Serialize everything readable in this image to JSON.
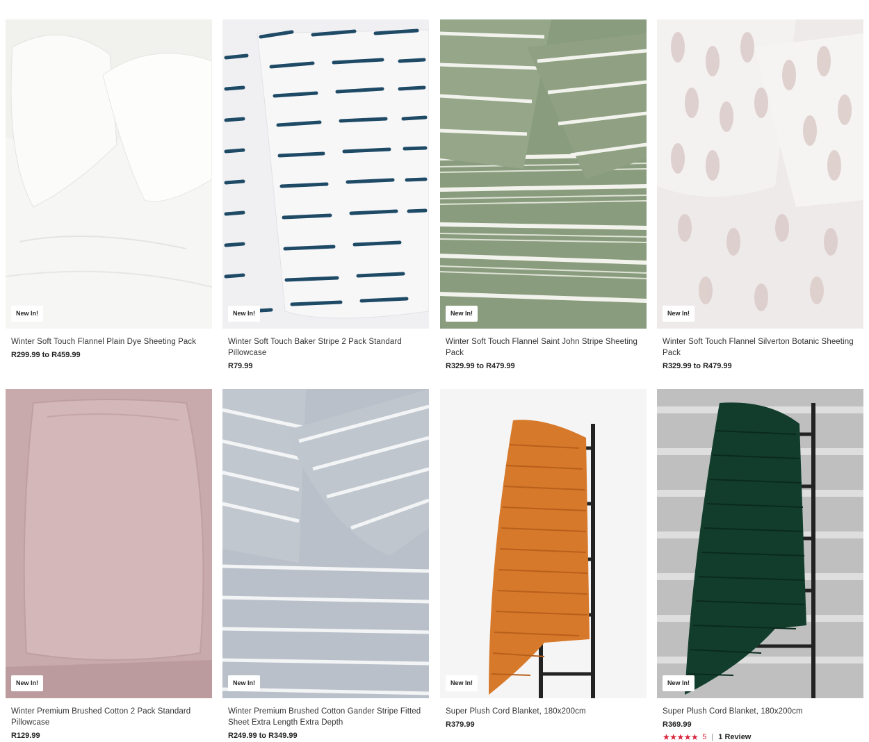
{
  "products": [
    {
      "badge": "New In!",
      "title": "Winter Soft Touch Flannel Plain Dye Sheeting Pack",
      "price": "R299.99 to R459.99"
    },
    {
      "badge": "New In!",
      "title": "Winter Soft Touch Baker Stripe 2 Pack Standard Pillowcase",
      "price": "R79.99"
    },
    {
      "badge": "New In!",
      "title": "Winter Soft Touch Flannel Saint John Stripe Sheeting Pack",
      "price": "R329.99 to R479.99"
    },
    {
      "badge": "New In!",
      "title": "Winter Soft Touch Flannel Silverton Botanic Sheeting Pack",
      "price": "R329.99 to R479.99"
    },
    {
      "badge": "New In!",
      "title": "Winter Premium Brushed Cotton 2 Pack Standard Pillowcase",
      "price": "R129.99"
    },
    {
      "badge": "New In!",
      "title": "Winter Premium Brushed Cotton Gander Stripe Fitted Sheet Extra Length Extra Depth",
      "price": "R249.99 to R349.99"
    },
    {
      "badge": "New In!",
      "title": "Super Plush Cord Blanket, 180x200cm",
      "price": "R379.99"
    },
    {
      "badge": "New In!",
      "title": "Super Plush Cord Blanket, 180x200cm",
      "price": "R369.99",
      "rating_value": "5",
      "rating_stars": 5,
      "review_text": "1 Review"
    }
  ],
  "colors": {
    "rating": "#d7233b",
    "navy_stripe": "#1e4a66",
    "sage": "#8a9c7e",
    "blush": "#c8a9ac",
    "orange": "#d7792a",
    "emerald": "#123d2c"
  }
}
